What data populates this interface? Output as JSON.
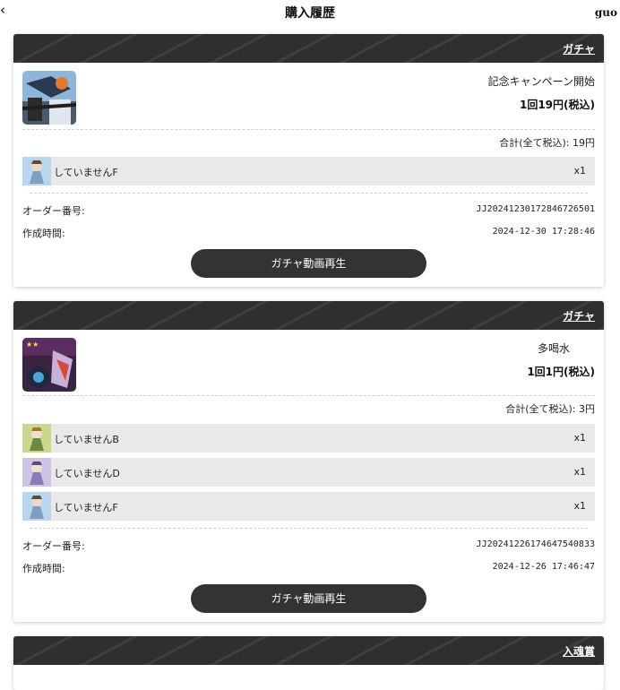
{
  "header": {
    "back_icon": "back-chevron-icon",
    "title": "購入履歴",
    "username": "guo"
  },
  "orders": [
    {
      "category": "ガチャ",
      "product_name": "記念キャンペーン開始",
      "price": "1回19円(税込)",
      "total": "合計(全て税込): 19円",
      "items": [
        {
          "name": "していませんF",
          "qty": "x1"
        }
      ],
      "order_no_label": "オーダー番号:",
      "order_no": "JJ20241230172846726501",
      "created_label": "作成時間:",
      "created": "2024-12-30 17:28:46",
      "button": "ガチャ動画再生"
    },
    {
      "category": "ガチャ",
      "product_name": "多喝水",
      "price": "1回1円(税込)",
      "total": "合計(全て税込): 3円",
      "items": [
        {
          "name": "していませんB",
          "qty": "x1"
        },
        {
          "name": "していませんD",
          "qty": "x1"
        },
        {
          "name": "していませんF",
          "qty": "x1"
        }
      ],
      "order_no_label": "オーダー番号:",
      "order_no": "JJ20241226174647540833",
      "created_label": "作成時間:",
      "created": "2024-12-26 17:46:47",
      "button": "ガチャ動画再生"
    },
    {
      "category": "入魂賞"
    }
  ],
  "colors": {
    "header_bg": "#2f2f2f",
    "button_bg": "#333333",
    "item_bg": "#e9e9e9"
  }
}
